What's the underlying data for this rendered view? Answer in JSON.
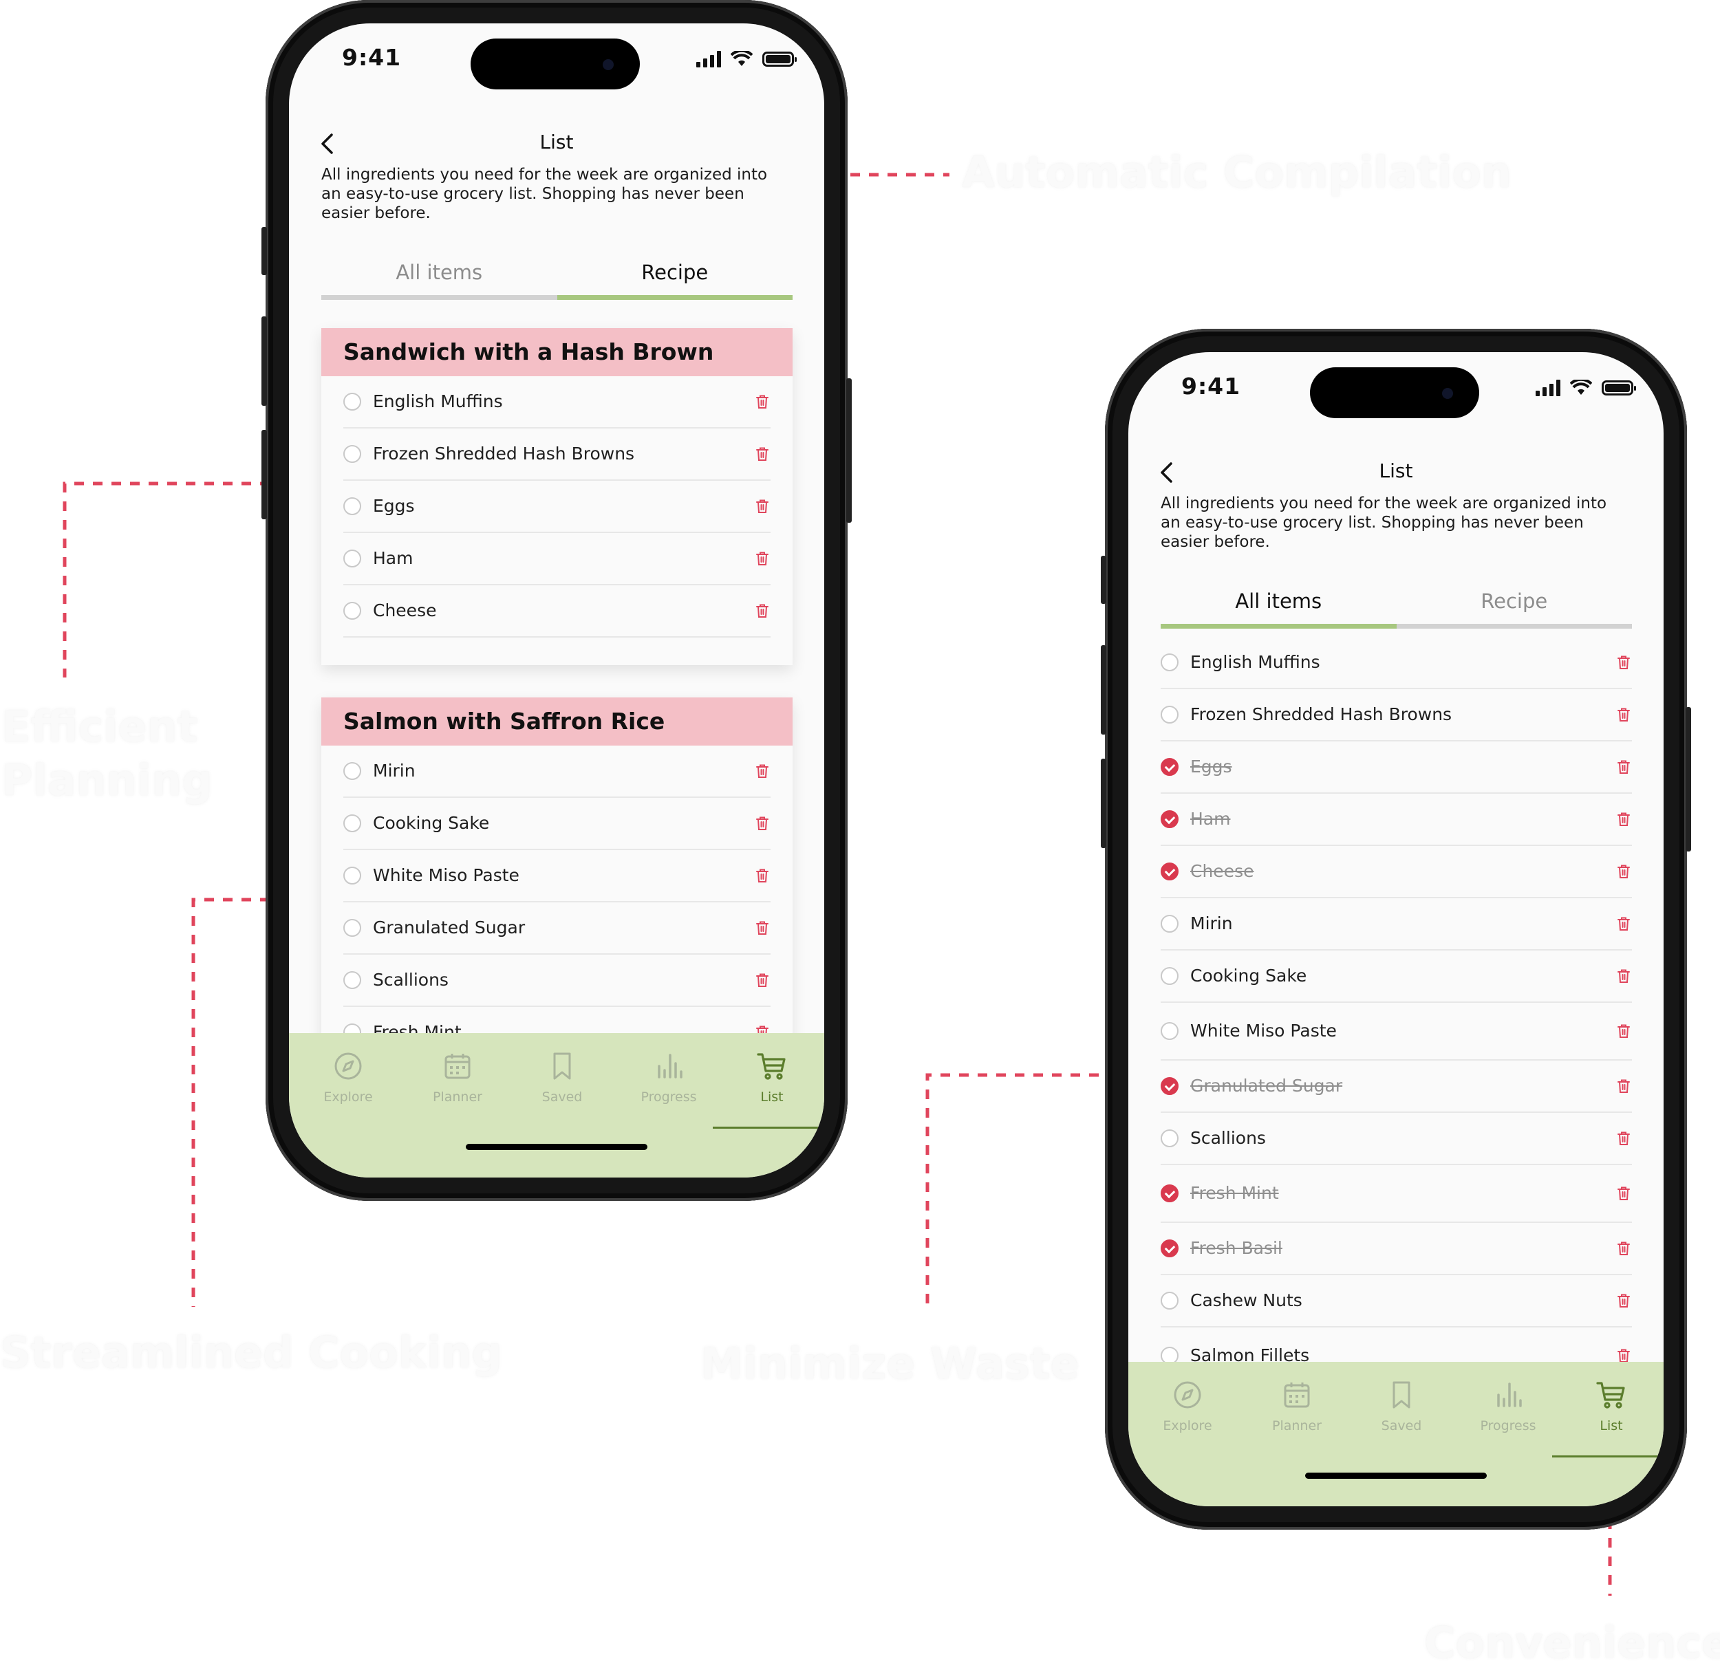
{
  "status": {
    "time": "9:41"
  },
  "nav": {
    "title": "List"
  },
  "description": "All ingredients you need for the week are organized into an easy-to-use grocery list. Shopping has never been easier before.",
  "tabs": {
    "all_items": "All items",
    "recipe": "Recipe"
  },
  "bottom_nav": [
    "Explore",
    "Planner",
    "Saved",
    "Progress",
    "List"
  ],
  "recipes": [
    {
      "title": "Sandwich with a Hash Brown",
      "items": [
        "English Muffins",
        "Frozen Shredded Hash Browns",
        "Eggs",
        "Ham",
        "Cheese"
      ]
    },
    {
      "title": "Salmon with Saffron Rice",
      "items": [
        "Mirin",
        "Cooking Sake",
        "White Miso Paste",
        "Granulated Sugar",
        "Scallions",
        "Fresh Mint"
      ]
    }
  ],
  "all_items": [
    {
      "name": "English Muffins",
      "checked": false
    },
    {
      "name": "Frozen Shredded Hash Browns",
      "checked": false
    },
    {
      "name": "Eggs",
      "checked": true
    },
    {
      "name": "Ham",
      "checked": true
    },
    {
      "name": "Cheese",
      "checked": true
    },
    {
      "name": "Mirin",
      "checked": false
    },
    {
      "name": "Cooking Sake",
      "checked": false
    },
    {
      "name": "White Miso Paste",
      "checked": false
    },
    {
      "name": "Granulated Sugar",
      "checked": true
    },
    {
      "name": "Scallions",
      "checked": false
    },
    {
      "name": "Fresh Mint",
      "checked": true
    },
    {
      "name": "Fresh Basil",
      "checked": true
    },
    {
      "name": "Cashew Nuts",
      "checked": false
    },
    {
      "name": "Salmon Fillets",
      "checked": false
    }
  ],
  "callouts": {
    "automatic": "Automatic Compilation",
    "efficient_1": "Efficient",
    "efficient_2": "Planning",
    "streamlined": "Streamlined Cooking",
    "minimize": "Minimize Waste",
    "convenience": "Convenience"
  },
  "colors": {
    "accent_green": "#a7c77f",
    "recipe_header": "#f4bfc6",
    "check_red": "#d9394e",
    "tabbar_bg": "#d6e5bc",
    "callout_line": "#e0455c"
  }
}
